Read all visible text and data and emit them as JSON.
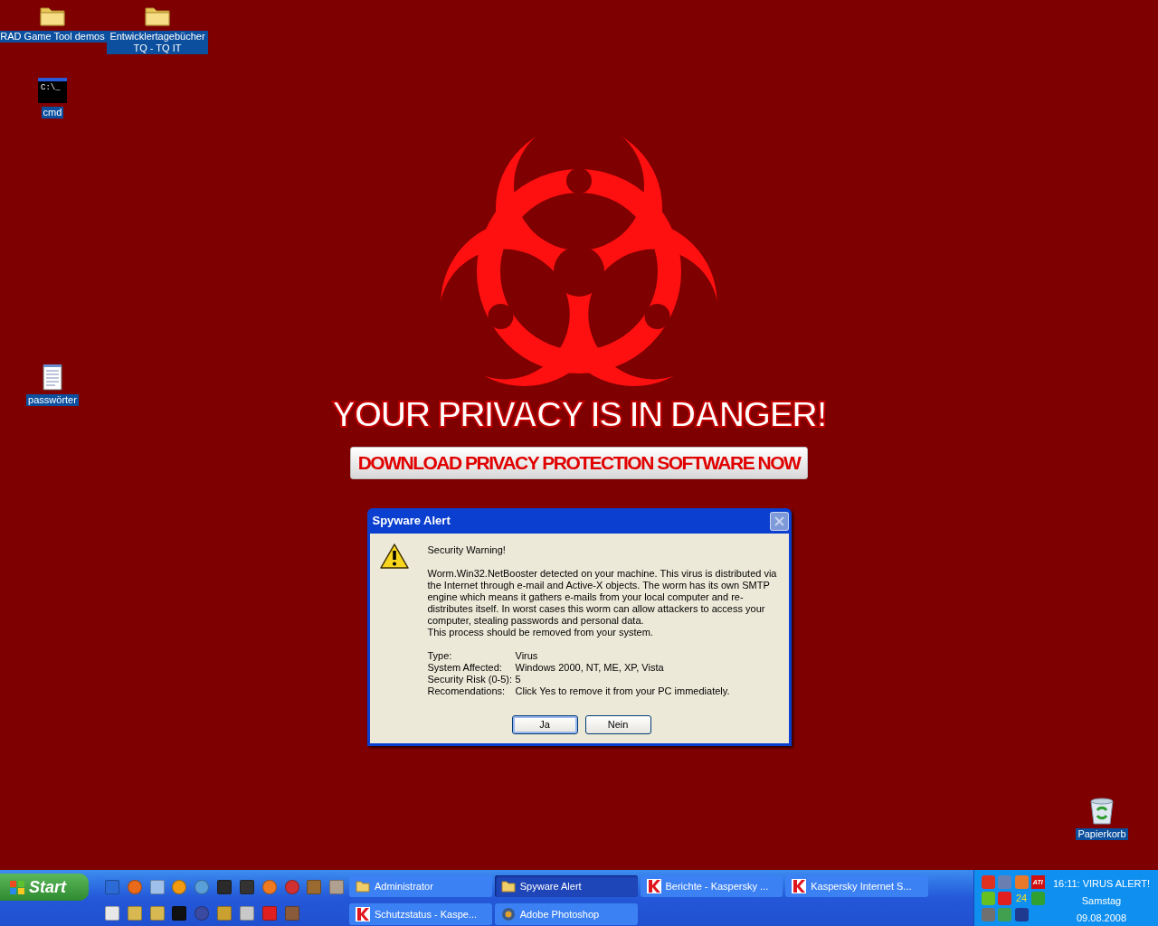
{
  "desktop_icons": [
    {
      "label": "RAD Game Tool demos",
      "kind": "folder"
    },
    {
      "label": "Entwicklertagebücher TQ - TQ IT",
      "kind": "folder"
    },
    {
      "label": "cmd",
      "kind": "console",
      "icon_text": "C:\\_"
    },
    {
      "label": "passwörter",
      "kind": "notepad"
    },
    {
      "label": "Papierkorb",
      "kind": "recycle"
    }
  ],
  "banner": {
    "headline": "YOUR PRIVACY IS IN DANGER!",
    "button": "DOWNLOAD PRIVACY PROTECTION SOFTWARE NOW"
  },
  "dialog": {
    "title": "Spyware Alert",
    "heading": "Security Warning!",
    "paragraphs": [
      "Worm.Win32.NetBooster detected on your machine. This virus is distributed via the Internet through e-mail and Active-X objects. The worm has its own SMTP engine which means it gathers e-mails from your local computer and re-distributes itself. In worst cases this worm can allow attackers to access your computer, stealing passwords and personal data.",
      "This process should be removed from your system."
    ],
    "details": [
      {
        "label": "Type:",
        "value": "Virus"
      },
      {
        "label": "System Affected:",
        "value": "Windows 2000, NT, ME, XP, Vista"
      },
      {
        "label": "Security Risk (0-5):",
        "value": "5"
      },
      {
        "label": "Recomendations:",
        "value": "Click Yes to remove it from your PC immediately."
      }
    ],
    "buttons": [
      {
        "label": "Ja",
        "selected": true
      },
      {
        "label": "Nein",
        "selected": false
      }
    ]
  },
  "taskbar": {
    "start": "Start",
    "tasks": [
      {
        "label": "Administrator",
        "kind": "folder",
        "selected": false
      },
      {
        "label": "Spyware Alert",
        "kind": "folder",
        "selected": true
      },
      {
        "label": "Berichte - Kaspersky ...",
        "kind": "kaspersky",
        "selected": false
      },
      {
        "label": "Kaspersky Internet S...",
        "kind": "kaspersky",
        "selected": false
      },
      {
        "label": "Schutzstatus - Kaspe...",
        "kind": "kaspersky",
        "selected": false
      },
      {
        "label": "Adobe Photoshop",
        "kind": "photoshop",
        "selected": false
      }
    ],
    "tray": {
      "clock": "16:11: VIRUS ALERT!",
      "day": "Samstag",
      "date": "09.08.2008",
      "badge": "ATI",
      "counter": "24"
    }
  }
}
